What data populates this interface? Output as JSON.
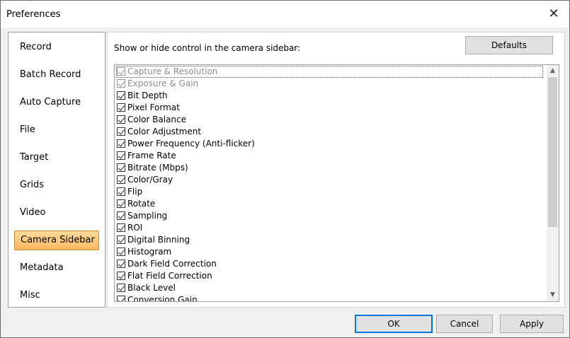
{
  "window": {
    "title": "Preferences",
    "close_glyph": "✕"
  },
  "nav": {
    "items": [
      {
        "label": "Record"
      },
      {
        "label": "Batch Record"
      },
      {
        "label": "Auto Capture"
      },
      {
        "label": "File"
      },
      {
        "label": "Target"
      },
      {
        "label": "Grids"
      },
      {
        "label": "Video"
      },
      {
        "label": "Camera Sidebar",
        "active": true
      },
      {
        "label": "Metadata"
      },
      {
        "label": "Misc"
      }
    ],
    "active_color": "#fbb85f"
  },
  "panel": {
    "label": "Show or hide control in the camera sidebar:",
    "defaults_label": "Defaults",
    "items": [
      {
        "label": "Capture & Resolution",
        "checked": true,
        "disabled": true,
        "focused": true
      },
      {
        "label": "Exposure & Gain",
        "checked": true,
        "disabled": true
      },
      {
        "label": "Bit Depth",
        "checked": true
      },
      {
        "label": "Pixel Format",
        "checked": true
      },
      {
        "label": "Color Balance",
        "checked": true
      },
      {
        "label": "Color Adjustment",
        "checked": true
      },
      {
        "label": "Power Frequency (Anti-flicker)",
        "checked": true
      },
      {
        "label": "Frame Rate",
        "checked": true
      },
      {
        "label": "Bitrate (Mbps)",
        "checked": true
      },
      {
        "label": "Color/Gray",
        "checked": true
      },
      {
        "label": "Flip",
        "checked": true
      },
      {
        "label": "Rotate",
        "checked": true
      },
      {
        "label": "Sampling",
        "checked": true
      },
      {
        "label": "ROI",
        "checked": true
      },
      {
        "label": "Digital Binning",
        "checked": true
      },
      {
        "label": "Histogram",
        "checked": true
      },
      {
        "label": "Dark Field Correction",
        "checked": true
      },
      {
        "label": "Flat Field Correction",
        "checked": true
      },
      {
        "label": "Black Level",
        "checked": true
      },
      {
        "label": "Conversion Gain",
        "checked": true
      }
    ],
    "scroll_up_glyph": "▲",
    "scroll_down_glyph": "▼"
  },
  "footer": {
    "ok_label": "OK",
    "cancel_label": "Cancel",
    "apply_label": "Apply"
  }
}
